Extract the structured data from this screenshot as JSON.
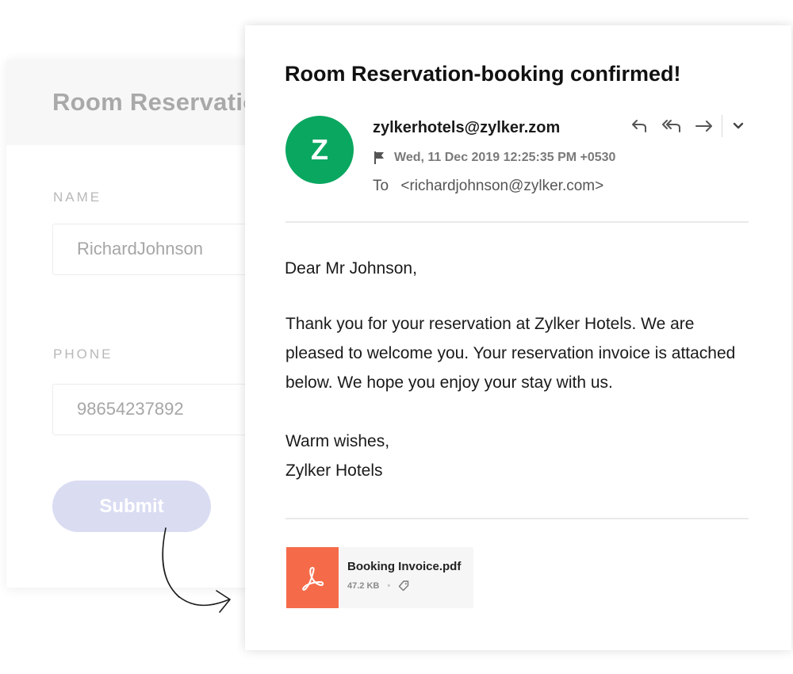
{
  "form": {
    "title": "Room Reservation",
    "name_label": "NAME",
    "name_value": "RichardJohnson",
    "phone_label": "PHONE",
    "phone_value": "98654237892",
    "submit_label": "Submit"
  },
  "email": {
    "subject": "Room Reservation-booking confirmed!",
    "avatar_letter": "Z",
    "sender": "zylkerhotels@zylker.zom",
    "date": "Wed, 11 Dec 2019 12:25:35 PM +0530",
    "to_label": "To",
    "to_address": "<richardjohnson@zylker.com>",
    "greeting": "Dear Mr Johnson,",
    "body": "Thank you for your reservation at Zylker Hotels. We are pleased to welcome you. Your reservation invoice is attached below. We hope you enjoy your stay with us.",
    "sign_off": "Warm wishes,",
    "signature": "Zylker Hotels",
    "attachment": {
      "filename": "Booking Invoice.pdf",
      "size": "47.2 KB",
      "icon": "pdf-icon"
    },
    "actions": [
      "reply-icon",
      "reply-all-icon",
      "forward-icon",
      "chevron-down-icon"
    ]
  },
  "colors": {
    "avatar_bg": "#0aa760",
    "pdf_tile": "#f56b4a",
    "submit_bg": "#dadcf2"
  }
}
